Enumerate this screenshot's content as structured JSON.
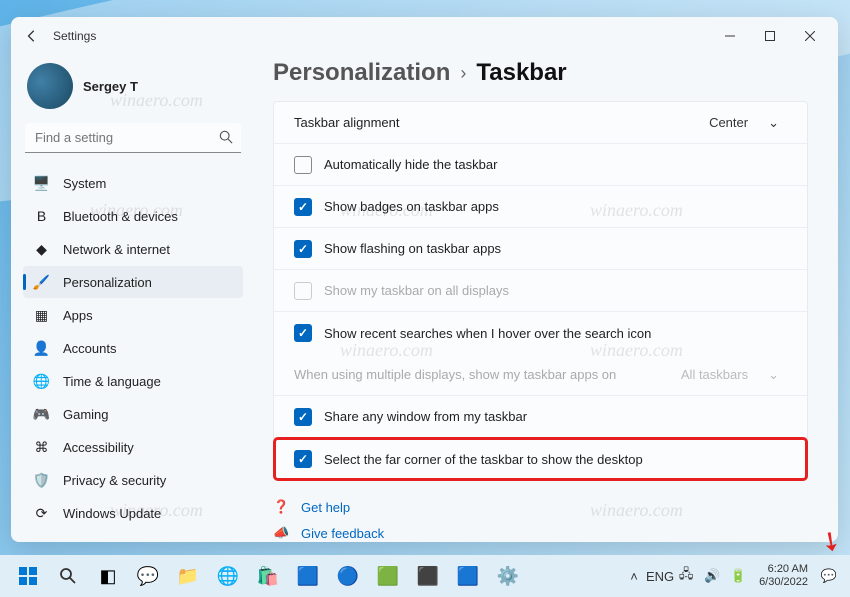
{
  "window": {
    "title": "Settings"
  },
  "user": {
    "name": "Sergey T"
  },
  "search": {
    "placeholder": "Find a setting"
  },
  "nav": {
    "items": [
      {
        "label": "System",
        "icon": "🖥️"
      },
      {
        "label": "Bluetooth & devices",
        "icon": "B"
      },
      {
        "label": "Network & internet",
        "icon": "◆"
      },
      {
        "label": "Personalization",
        "icon": "🖌️"
      },
      {
        "label": "Apps",
        "icon": "▦"
      },
      {
        "label": "Accounts",
        "icon": "👤"
      },
      {
        "label": "Time & language",
        "icon": "🌐"
      },
      {
        "label": "Gaming",
        "icon": "🎮"
      },
      {
        "label": "Accessibility",
        "icon": "⌘"
      },
      {
        "label": "Privacy & security",
        "icon": "🛡️"
      },
      {
        "label": "Windows Update",
        "icon": "⟳"
      }
    ],
    "active_index": 3
  },
  "breadcrumb": {
    "parent": "Personalization",
    "current": "Taskbar"
  },
  "settings": {
    "alignment_label": "Taskbar alignment",
    "alignment_value": "Center",
    "rows": [
      {
        "label": "Automatically hide the taskbar",
        "checked": false,
        "disabled": false
      },
      {
        "label": "Show badges on taskbar apps",
        "checked": true,
        "disabled": false
      },
      {
        "label": "Show flashing on taskbar apps",
        "checked": true,
        "disabled": false
      },
      {
        "label": "Show my taskbar on all displays",
        "checked": false,
        "disabled": true
      },
      {
        "label": "Show recent searches when I hover over the search icon",
        "checked": true,
        "disabled": false
      }
    ],
    "multi_display_label": "When using multiple displays, show my taskbar apps on",
    "multi_display_value": "All taskbars",
    "share_label": "Share any window from my taskbar",
    "corner_label": "Select the far corner of the taskbar to show the desktop"
  },
  "help": {
    "get_help": "Get help",
    "feedback": "Give feedback"
  },
  "taskbar": {
    "lang": "ENG",
    "time": "6:20 AM",
    "date": "6/30/2022"
  },
  "watermark": "winaero.com"
}
